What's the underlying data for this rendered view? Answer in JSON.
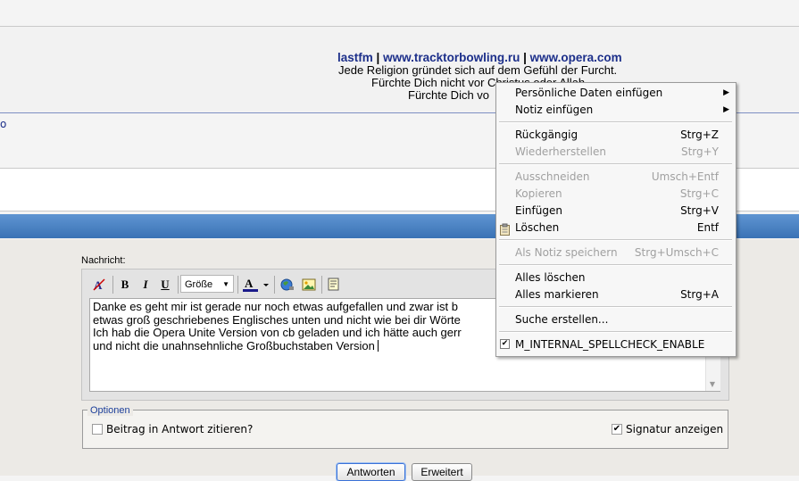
{
  "signature": {
    "link1": "lastfm",
    "sep": "|",
    "link2": "www.tracktorbowling.ru",
    "link3": "www.opera.com",
    "line1": "Jede Religion gründet sich auf dem Gefühl der Furcht.",
    "line2": "Fürchte Dich nicht vor Christus oder Allah.",
    "line3": "Fürchte Dich vo"
  },
  "left_fragment": "o",
  "editor": {
    "label": "Nachricht:",
    "size_select": "Größe",
    "text_lines": [
      "Danke es geht mir ist gerade nur noch etwas aufgefallen und zwar ist b",
      "etwas groß geschriebenes Englisches unten und nicht wie bei dir Wörte",
      "",
      "Ich hab die Opera Unite Version von cb geladen und ich hätte auch gerr",
      "und nicht die unahnsehnliche Großbuchstaben Version "
    ]
  },
  "options": {
    "legend": "Optionen",
    "quote_label": "Beitrag in Antwort zitieren?",
    "quote_checked": false,
    "signature_label": "Signatur anzeigen",
    "signature_checked": true
  },
  "buttons": {
    "reply": "Antworten",
    "advanced": "Erweitert"
  },
  "context_menu": {
    "items": [
      {
        "label": "Persönliche Daten einfügen",
        "shortcut": "",
        "submenu": true,
        "disabled": false
      },
      {
        "label": "Notiz einfügen",
        "shortcut": "",
        "submenu": true,
        "disabled": false
      },
      {
        "label": "Rückgängig",
        "shortcut": "Strg+Z",
        "disabled": false
      },
      {
        "label": "Wiederherstellen",
        "shortcut": "Strg+Y",
        "disabled": true
      },
      {
        "label": "Ausschneiden",
        "shortcut": "Umsch+Entf",
        "disabled": true
      },
      {
        "label": "Kopieren",
        "shortcut": "Strg+C",
        "disabled": true
      },
      {
        "label": "Einfügen",
        "shortcut": "Strg+V",
        "disabled": false
      },
      {
        "label": "Löschen",
        "shortcut": "Entf",
        "disabled": false
      },
      {
        "label": "Als Notiz speichern",
        "shortcut": "Strg+Umsch+C",
        "disabled": true
      },
      {
        "label": "Alles löschen",
        "shortcut": "",
        "disabled": false
      },
      {
        "label": "Alles markieren",
        "shortcut": "Strg+A",
        "disabled": false
      },
      {
        "label": "Suche erstellen...",
        "shortcut": "",
        "disabled": false
      },
      {
        "label": "M_INTERNAL_SPELLCHECK_ENABLE",
        "shortcut": "",
        "disabled": false,
        "checked": true
      }
    ]
  },
  "colors": {
    "link": "#1c2f8a",
    "header_bar": "#4a80c0",
    "legend": "#1c3f9a"
  }
}
